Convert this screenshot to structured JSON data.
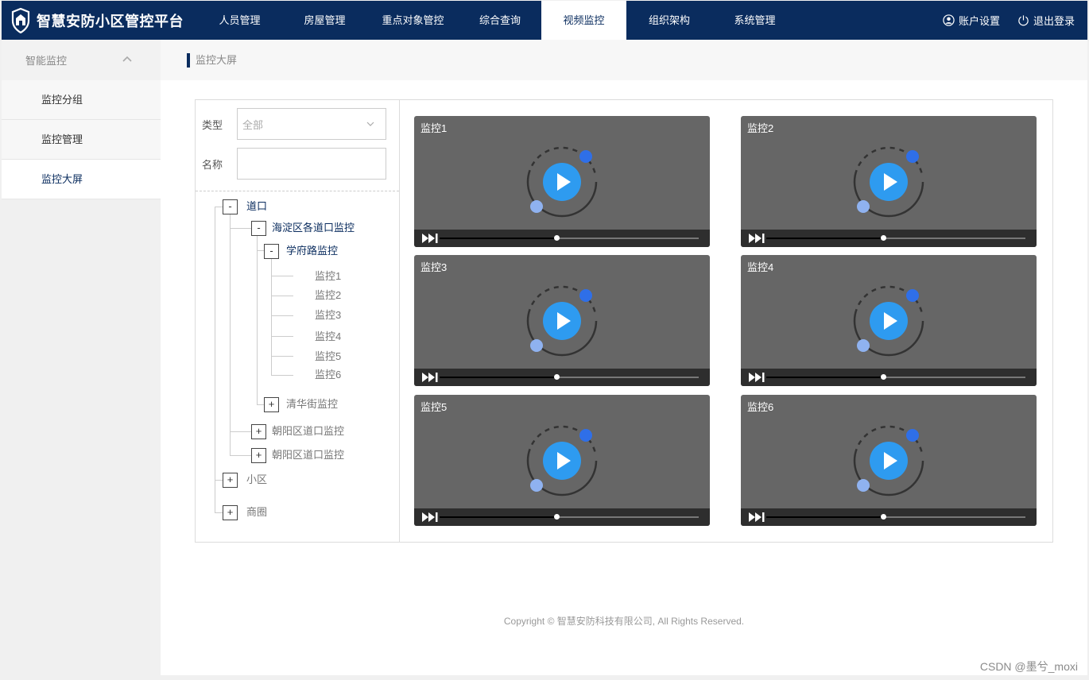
{
  "app": {
    "title": "智慧安防小区管控平台"
  },
  "nav": {
    "items": [
      "人员管理",
      "房屋管理",
      "重点对象管控",
      "综合查询",
      "视频监控",
      "组织架构",
      "系统管理"
    ],
    "active_index": 4
  },
  "header_right": {
    "account": "账户设置",
    "logout": "退出登录"
  },
  "sidebar": {
    "title": "智能监控",
    "items": [
      "监控分组",
      "监控管理",
      "监控大屏"
    ],
    "active_index": 2
  },
  "breadcrumb": "监控大屏",
  "filter": {
    "type_label": "类型",
    "type_value": "全部",
    "name_label": "名称",
    "name_value": ""
  },
  "tree": {
    "root1": {
      "label": "道口",
      "toggle": "-"
    },
    "district1": {
      "label": "海淀区各道口监控",
      "toggle": "-"
    },
    "road1": {
      "label": "学府路监控",
      "toggle": "-"
    },
    "cams": [
      "监控1",
      "监控2",
      "监控3",
      "监控4",
      "监控5",
      "监控6"
    ],
    "road2": {
      "label": "清华街监控",
      "toggle": "+"
    },
    "district2": {
      "label": "朝阳区道口监控",
      "toggle": "+"
    },
    "district3": {
      "label": "朝阳区道口监控",
      "toggle": "+"
    },
    "root2": {
      "label": "小区",
      "toggle": "+"
    },
    "root3": {
      "label": "商圈",
      "toggle": "+"
    }
  },
  "videos": [
    {
      "title": "监控1",
      "progress": 0.45
    },
    {
      "title": "监控2",
      "progress": 0.45
    },
    {
      "title": "监控3",
      "progress": 0.45
    },
    {
      "title": "监控4",
      "progress": 0.45
    },
    {
      "title": "监控5",
      "progress": 0.45
    },
    {
      "title": "监控6",
      "progress": 0.45
    }
  ],
  "footer": "Copyright © 智慧安防科技有限公司, All Rights Reserved.",
  "watermark": "CSDN @墨兮_moxi",
  "colors": {
    "brand": "#0a2c5e",
    "play": "#2e9bf0",
    "video_bg": "#666666"
  },
  "icons": {
    "logo": "shield-home-icon",
    "account": "user-circle-icon",
    "logout": "power-icon",
    "play": "play-icon",
    "ff": "fast-forward-icon"
  }
}
